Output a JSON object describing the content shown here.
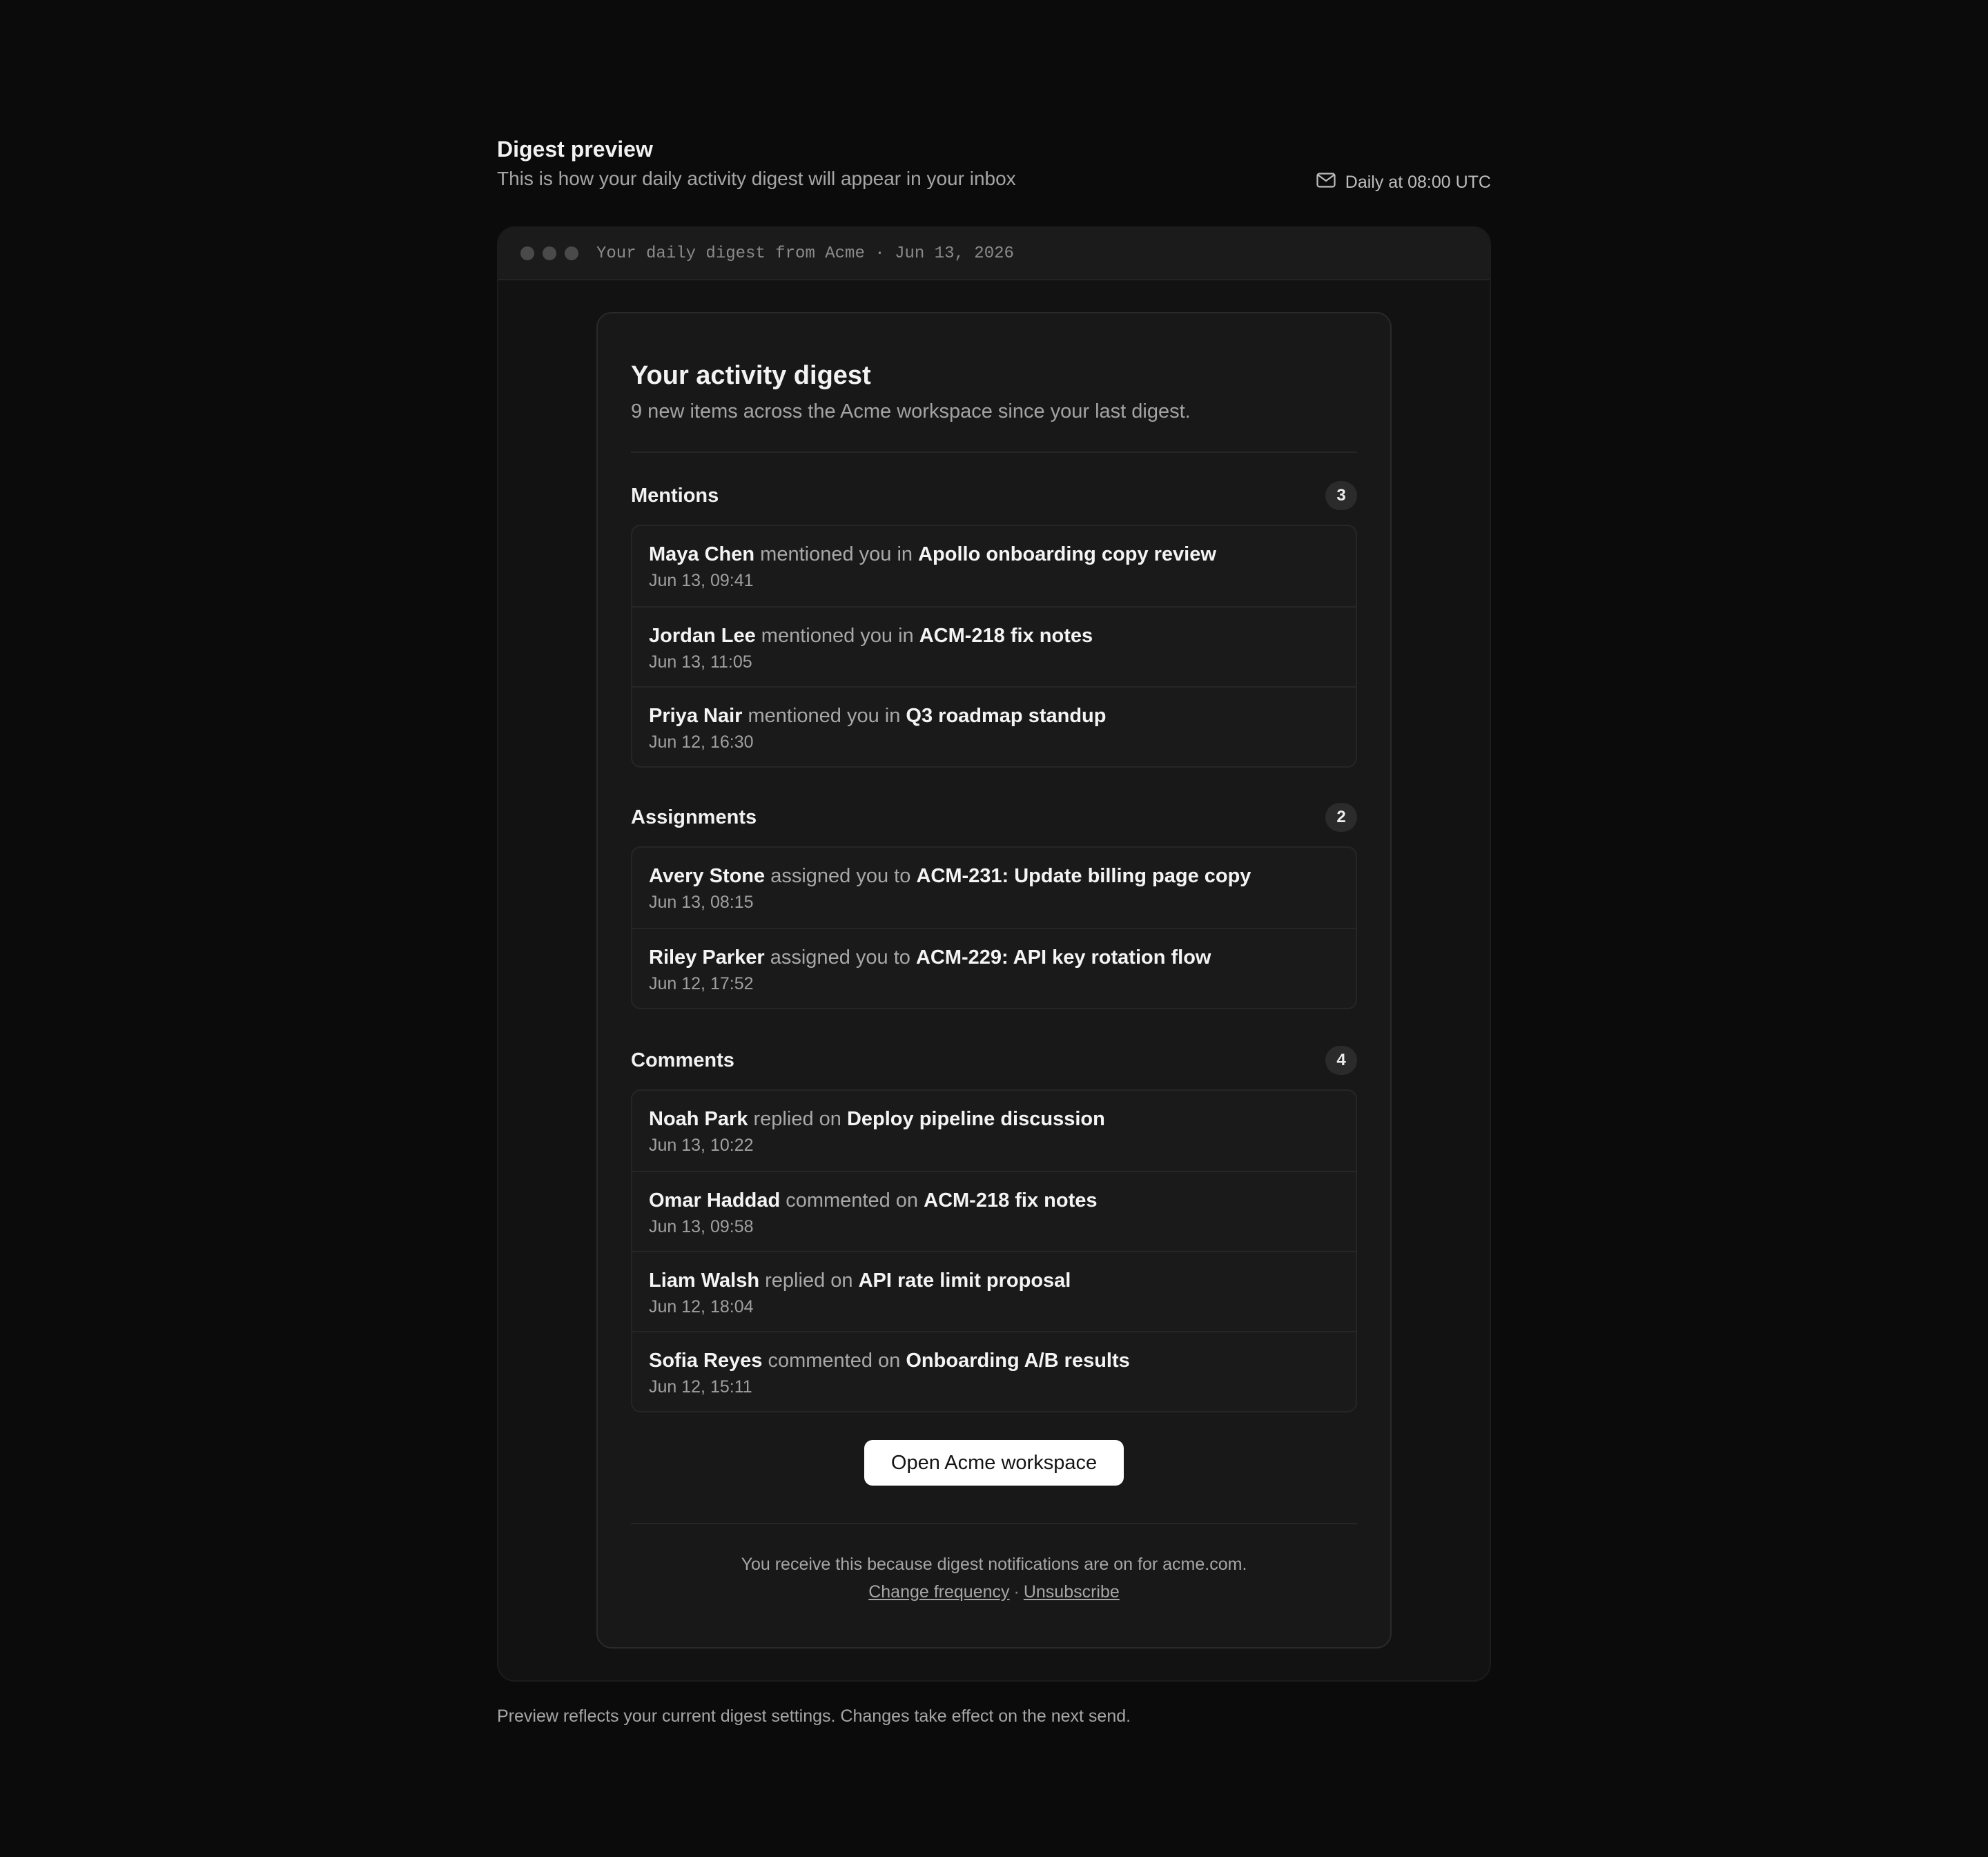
{
  "header": {
    "title": "Digest preview",
    "subtitle": "This is how your daily activity digest will appear in your inbox",
    "schedule": "Daily at 08:00 UTC",
    "schedule_icon": "mail-icon"
  },
  "frame": {
    "subject": "Your daily digest from Acme · Jun 13, 2026"
  },
  "email": {
    "title": "Your activity digest",
    "subtitle": "9 new items across the Acme workspace since your last digest.",
    "sections": [
      {
        "title": "Mentions",
        "count": "3",
        "items": [
          {
            "actor": "Maya Chen",
            "verb": "mentioned you in",
            "target": "Apollo onboarding copy review",
            "time": "Jun 13, 09:41"
          },
          {
            "actor": "Jordan Lee",
            "verb": "mentioned you in",
            "target": "ACM-218 fix notes",
            "time": "Jun 13, 11:05"
          },
          {
            "actor": "Priya Nair",
            "verb": "mentioned you in",
            "target": "Q3 roadmap standup",
            "time": "Jun 12, 16:30"
          }
        ]
      },
      {
        "title": "Assignments",
        "count": "2",
        "items": [
          {
            "actor": "Avery Stone",
            "verb": "assigned you to",
            "target": "ACM-231: Update billing page copy",
            "time": "Jun 13, 08:15"
          },
          {
            "actor": "Riley Parker",
            "verb": "assigned you to",
            "target": "ACM-229: API key rotation flow",
            "time": "Jun 12, 17:52"
          }
        ]
      },
      {
        "title": "Comments",
        "count": "4",
        "items": [
          {
            "actor": "Noah Park",
            "verb": "replied on",
            "target": "Deploy pipeline discussion",
            "time": "Jun 13, 10:22"
          },
          {
            "actor": "Omar Haddad",
            "verb": "commented on",
            "target": "ACM-218 fix notes",
            "time": "Jun 13, 09:58"
          },
          {
            "actor": "Liam Walsh",
            "verb": "replied on",
            "target": "API rate limit proposal",
            "time": "Jun 12, 18:04"
          },
          {
            "actor": "Sofia Reyes",
            "verb": "commented on",
            "target": "Onboarding A/B results",
            "time": "Jun 12, 15:11"
          }
        ]
      }
    ],
    "cta_label": "Open Acme workspace",
    "footer_note": "You receive this because digest notifications are on for acme.com.",
    "change_frequency": "Change frequency",
    "separator": "·",
    "unsubscribe": "Unsubscribe"
  },
  "below_note": "Preview reflects your current digest settings. Changes take effect on the next send.",
  "colors": {
    "background": "#0b0b0b",
    "card": "#181818",
    "accent_button": "#ffffff"
  }
}
